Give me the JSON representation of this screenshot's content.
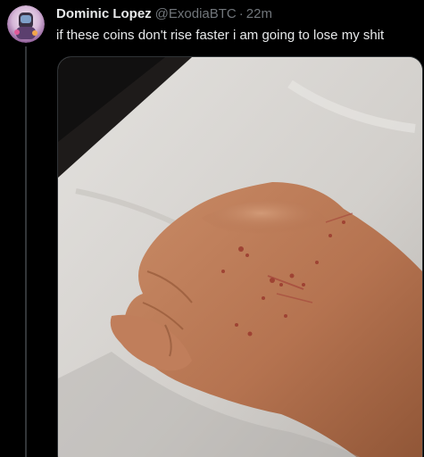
{
  "tweet": {
    "display_name": "Dominic Lopez",
    "handle": "@ExodiaBTC",
    "separator": "·",
    "timestamp": "22m",
    "text": "if these coins don't rise faster i am going to lose my shit"
  },
  "colors": {
    "background": "#000000",
    "text_primary": "#e7e9ea",
    "text_secondary": "#71767b",
    "border": "#2f3336"
  },
  "icons": {
    "avatar": "user-avatar-icon"
  }
}
